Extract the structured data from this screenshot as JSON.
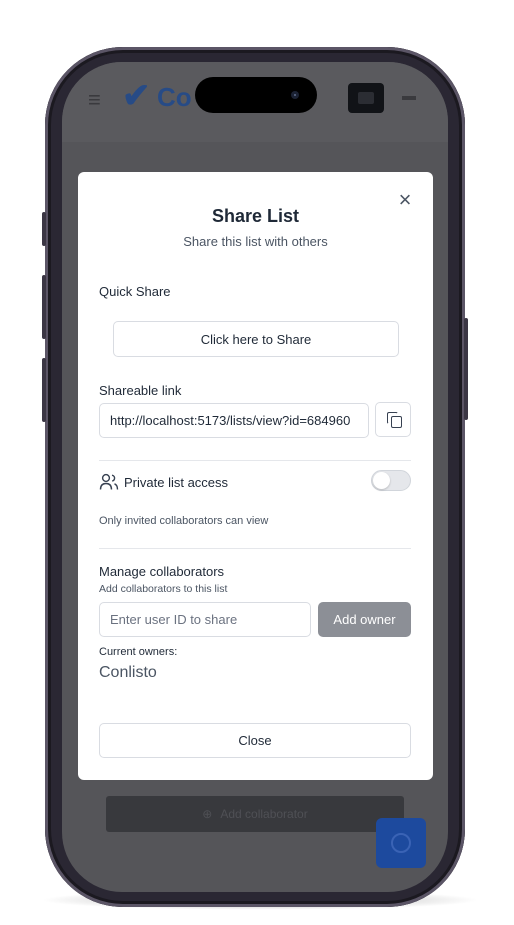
{
  "app": {
    "logo_text": "Co",
    "background_button_label": "Add collaborator"
  },
  "modal": {
    "title": "Share List",
    "subtitle": "Share this list with others",
    "quick_share": {
      "label": "Quick Share",
      "button_label": "Click here to Share"
    },
    "shareable_link": {
      "label": "Shareable link",
      "value": "http://localhost:5173/lists/view?id=684960"
    },
    "private_access": {
      "label": "Private list access",
      "enabled": false,
      "helper": "Only invited collaborators can view"
    },
    "collaborators": {
      "title": "Manage collaborators",
      "subtitle": "Add collaborators to this list",
      "input_placeholder": "Enter user ID to share",
      "add_button_label": "Add owner",
      "current_owners_label": "Current owners:",
      "owners": [
        "Conlisto"
      ]
    },
    "close_button_label": "Close"
  },
  "colors": {
    "overlay": "#555559",
    "add_owner_button": "#8c8f96",
    "fab": "#1d4a9e"
  },
  "icons": [
    "close-icon",
    "copy-icon",
    "users-icon",
    "menu-icon",
    "checkmark-logo-icon"
  ]
}
